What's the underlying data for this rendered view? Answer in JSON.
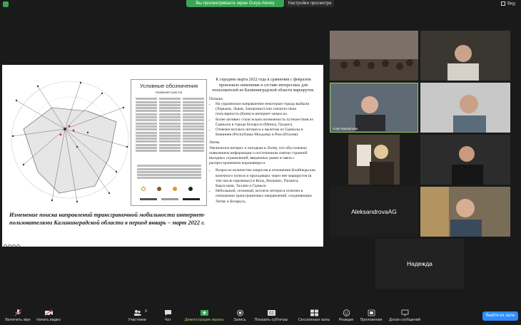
{
  "topbar": {
    "sharing_banner": "Вы просматриваете экран Gurya Alexey",
    "view_options": "Настройки просмотра",
    "view_button": "Вид"
  },
  "slide": {
    "legend_title": "Условные обозначения",
    "legend_subtitle": "Названия пунктов",
    "caption": "Изменение поиска направлений трансграничной мобильности интернет-пользователями Калининградской области в период январь – март 2022 г.",
    "intro": "К середине марта 2022 года в сравнении с февралем произошло изменение в составе интересных для пользователей из Калининградской области маршрутов.",
    "poland_heading": "Польша",
    "poland_items": [
      "На украинском направлении некоторые города выбыли (Харьков, Львов, Запорожье) или снизили свою популярность (Киев) в интернет-запросах.",
      "Более активно стали искать возможность путешествия из Гданьска в города Беларуси (Минск, Гродно).",
      "Отмечен всплеск интереса к вылетам из Гданьска в Кишинев (Республика Молдова) и Рим (Италия)."
    ],
    "lithuania_heading": "Литва",
    "lithuania_text": "Увеличился интерес к поездкам в Литву, что обусловлено появлением информации о постепенном снятии странной въездных ограничений, введенных ранее в связи с распространением коронавируса.",
    "lithuania_items": [
      "Возросло количество запросов в отношении Клайпеды как конечного пункта и проходящих через нее маршрутов (в том числе паромных) в Киль, Вильнюс, Паланга, Карлсхамн, Таллин и Гданьск.",
      "Небольшой, сезонный, всплеск интереса отмечен в отношении трансграничных направлений, соединяющих Литву и Беларусь."
    ]
  },
  "participants": [
    {
      "name": ""
    },
    {
      "name": ""
    },
    {
      "name": "Алия Михайлова"
    },
    {
      "name": ""
    },
    {
      "name": ""
    },
    {
      "name": ""
    },
    {
      "name": "AleksandrovaAG"
    },
    {
      "name": ""
    },
    {
      "name": "Надежда"
    }
  ],
  "toolbar": {
    "audio": "Включить звук",
    "video": "Начать видео",
    "participants": "Участники",
    "participants_count": "9",
    "chat": "Чат",
    "share": "Демонстрация экрана",
    "record": "Запись",
    "subtitles": "Показать субтитры",
    "breakout": "Сессионные залы",
    "reactions": "Реакции",
    "apps": "Приложения",
    "whiteboard": "Доски сообщений",
    "leave": "Выйти из зала"
  },
  "colors": {
    "accent": "#2d8cff",
    "share_green": "#3aa655",
    "background": "#1a1a1a"
  }
}
